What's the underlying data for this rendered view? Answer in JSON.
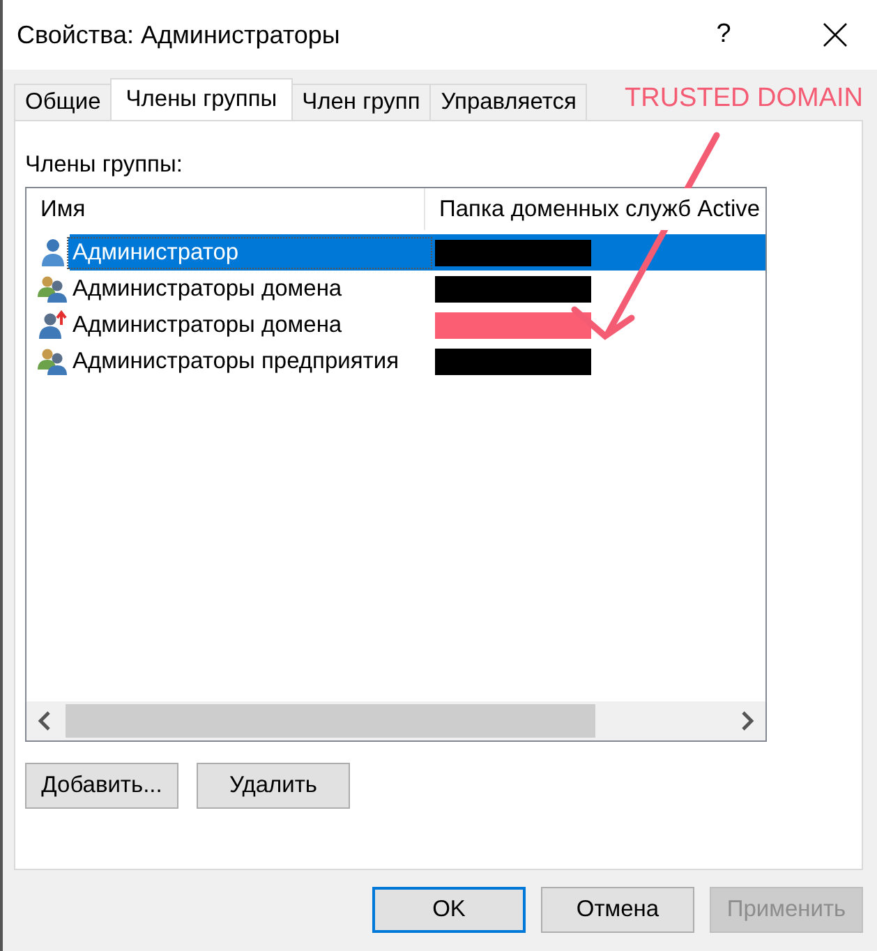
{
  "window": {
    "title": "Свойства: Администраторы",
    "help": "?"
  },
  "tabs": [
    {
      "label": "Общие",
      "selected": false
    },
    {
      "label": "Члены группы",
      "selected": true
    },
    {
      "label": "Член групп",
      "selected": false
    },
    {
      "label": "Управляется",
      "selected": false
    }
  ],
  "members_label": "Члены группы:",
  "table": {
    "columns": [
      "Имя",
      "Папка доменных служб Active"
    ],
    "rows": [
      {
        "kind": "user",
        "name": "Администратор",
        "selected": true,
        "color": "#000000"
      },
      {
        "kind": "group",
        "name": "Администраторы домена",
        "selected": false,
        "color": "#000000"
      },
      {
        "kind": "foreign",
        "name": "Администраторы домена",
        "selected": false,
        "color": "#fb5d73"
      },
      {
        "kind": "group",
        "name": "Администраторы предприятия",
        "selected": false,
        "color": "#000000"
      }
    ]
  },
  "list_buttons": [
    "Добавить...",
    "Удалить"
  ],
  "dialog_buttons": [
    {
      "label": "OK",
      "default": true,
      "disabled": false
    },
    {
      "label": "Отмена",
      "default": false,
      "disabled": false
    },
    {
      "label": "Применить",
      "default": false,
      "disabled": true
    }
  ],
  "annotation": {
    "text": "TRUSTED DOMAIN",
    "color": "#f45c74"
  }
}
